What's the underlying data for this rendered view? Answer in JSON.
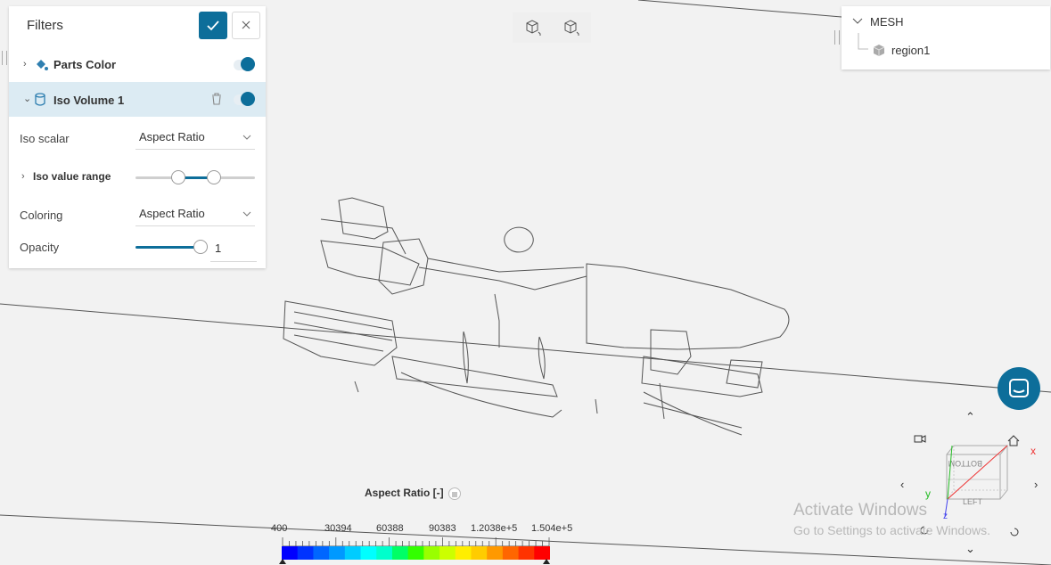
{
  "filters_panel": {
    "title": "Filters",
    "apply_icon": "check-icon",
    "close_icon": "close-icon",
    "items": [
      {
        "label": "Parts Color",
        "icon": "paint-bucket-icon",
        "enabled": true
      },
      {
        "label": "Iso Volume 1",
        "icon": "cylinder-icon",
        "enabled": true
      }
    ],
    "iso_scalar": {
      "label": "Iso scalar",
      "value": "Aspect Ratio"
    },
    "iso_value_range": {
      "label": "Iso value range",
      "low_fraction": 0.32,
      "high_fraction": 0.62
    },
    "coloring": {
      "label": "Coloring",
      "value": "Aspect Ratio"
    },
    "opacity": {
      "label": "Opacity",
      "value": "1",
      "fraction": 1.0
    }
  },
  "view_toolbar": {
    "buttons": [
      "cube-view-icon",
      "cube-view-icon"
    ]
  },
  "tree": {
    "root": "MESH",
    "children": [
      "region1"
    ]
  },
  "legend": {
    "title": "Aspect Ratio [-]",
    "ticks": [
      "400",
      "30394",
      "60388",
      "90383",
      "1.2038e+5",
      "1.504e+5"
    ],
    "colors": [
      "#0000ff",
      "#0033ff",
      "#0066ff",
      "#0099ff",
      "#00ccff",
      "#00ffff",
      "#00ffcc",
      "#00ff66",
      "#33ff00",
      "#99ff00",
      "#ccff00",
      "#ffee00",
      "#ffcc00",
      "#ff9900",
      "#ff6600",
      "#ff3300",
      "#ff0000"
    ]
  },
  "navigator": {
    "axes": [
      "x",
      "y",
      "z"
    ],
    "face_labels": [
      "LEFT",
      "BOTTOM"
    ]
  },
  "watermark": {
    "line1": "Activate Windows",
    "line2": "Go to Settings to activate Windows."
  },
  "colors": {
    "accent": "#0d6e9a"
  }
}
